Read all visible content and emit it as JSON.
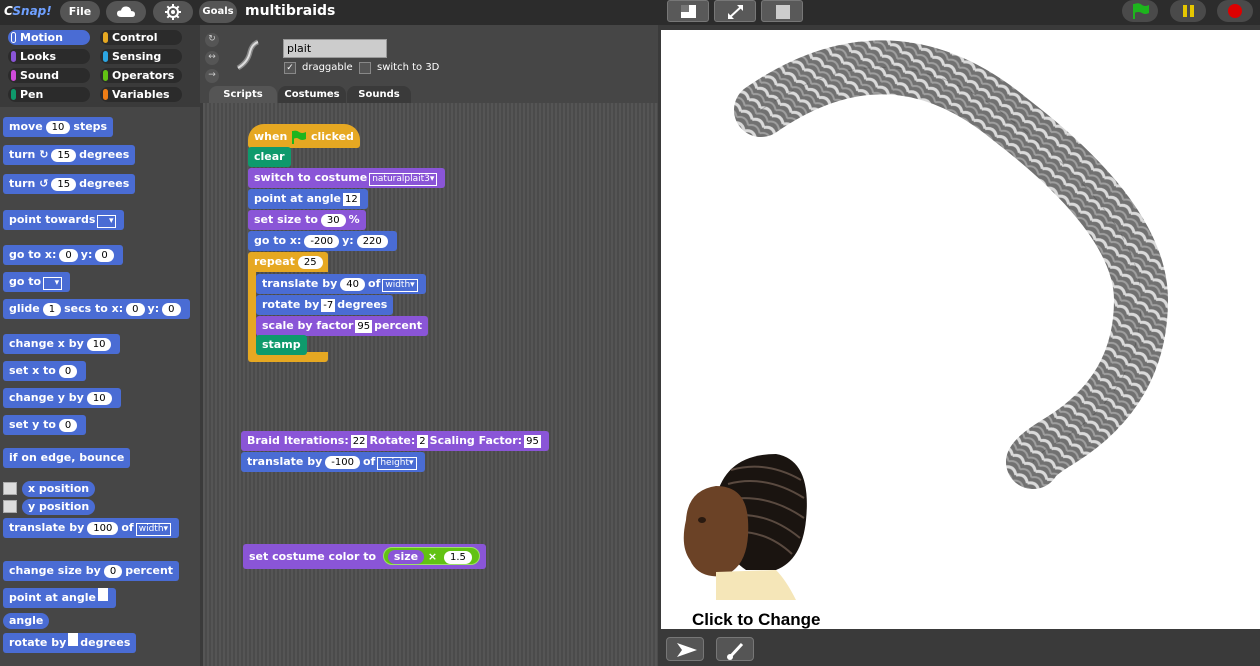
{
  "app": {
    "logo_main": "Snap",
    "logo_prefix": "C",
    "project_title": "multibraids"
  },
  "topbar": {
    "file_label": "File",
    "goals_label": "Goals"
  },
  "categories": [
    {
      "label": "Motion",
      "color": "#4a6cd4"
    },
    {
      "label": "Control",
      "color": "#e6a822"
    },
    {
      "label": "Looks",
      "color": "#8a55d7"
    },
    {
      "label": "Sensing",
      "color": "#2ca5e2"
    },
    {
      "label": "Sound",
      "color": "#cf4ad9"
    },
    {
      "label": "Operators",
      "color": "#62c213"
    },
    {
      "label": "Pen",
      "color": "#0e9a6c"
    },
    {
      "label": "Variables",
      "color": "#ee7d16"
    }
  ],
  "palette": {
    "move": {
      "a": "move",
      "v": "10",
      "b": "steps"
    },
    "turn_cw": {
      "a": "turn",
      "v": "15",
      "b": "degrees"
    },
    "turn_ccw": {
      "a": "turn",
      "v": "15",
      "b": "degrees"
    },
    "point_towards": "point towards",
    "goto_xy": {
      "a": "go to x:",
      "x": "0",
      "b": "y:",
      "y": "0"
    },
    "goto": "go to",
    "glide": {
      "a": "glide",
      "v": "1",
      "b": "secs to x:",
      "x": "0",
      "c": "y:",
      "y": "0"
    },
    "change_x": {
      "a": "change x by",
      "v": "10"
    },
    "set_x": {
      "a": "set x to",
      "v": "0"
    },
    "change_y": {
      "a": "change y by",
      "v": "10"
    },
    "set_y": {
      "a": "set y to",
      "v": "0"
    },
    "bounce": "if on edge, bounce",
    "x_position": "x position",
    "y_position": "y position",
    "translate": {
      "a": "translate by",
      "v": "100",
      "b": "of",
      "dd": "width"
    },
    "change_size": {
      "a": "change size by",
      "v": "0",
      "b": "percent"
    },
    "point_at_angle": "point at angle",
    "angle": "angle",
    "rotate_by": {
      "a": "rotate by",
      "b": "degrees"
    }
  },
  "sprite": {
    "name": "plait",
    "draggable_label": "draggable",
    "switch3d_label": "switch to 3D",
    "draggable_checked": "✓"
  },
  "tabs": [
    {
      "label": "Scripts"
    },
    {
      "label": "Costumes"
    },
    {
      "label": "Sounds"
    }
  ],
  "script1": {
    "hat": {
      "a": "when",
      "b": "clicked"
    },
    "clear": "clear",
    "switch_costume": {
      "a": "switch to costume",
      "dd": "naturalplait3"
    },
    "point_angle": {
      "a": "point at angle",
      "v": "12"
    },
    "set_size": {
      "a": "set size to",
      "v": "30",
      "b": "%"
    },
    "goto": {
      "a": "go to x:",
      "x": "-200",
      "b": "y:",
      "y": "220"
    },
    "repeat": {
      "a": "repeat",
      "v": "25"
    },
    "translate": {
      "a": "translate by",
      "v": "40",
      "b": "of",
      "dd": "width"
    },
    "rotate": {
      "a": "rotate by",
      "v": "-7",
      "b": "degrees"
    },
    "scale": {
      "a": "scale by factor",
      "v": "95",
      "b": "percent"
    },
    "stamp": "stamp"
  },
  "script2": {
    "braid": {
      "a": "Braid Iterations:",
      "v1": "22",
      "b": "Rotate:",
      "v2": "2",
      "c": "Scaling Factor:",
      "v3": "95"
    },
    "translate": {
      "a": "translate by",
      "v": "-100",
      "b": "of",
      "dd": "height"
    }
  },
  "script3": {
    "a": "set costume color to",
    "r": "size",
    "op": "×",
    "v": "1.5"
  },
  "stage": {
    "caption": "Click to Change"
  }
}
